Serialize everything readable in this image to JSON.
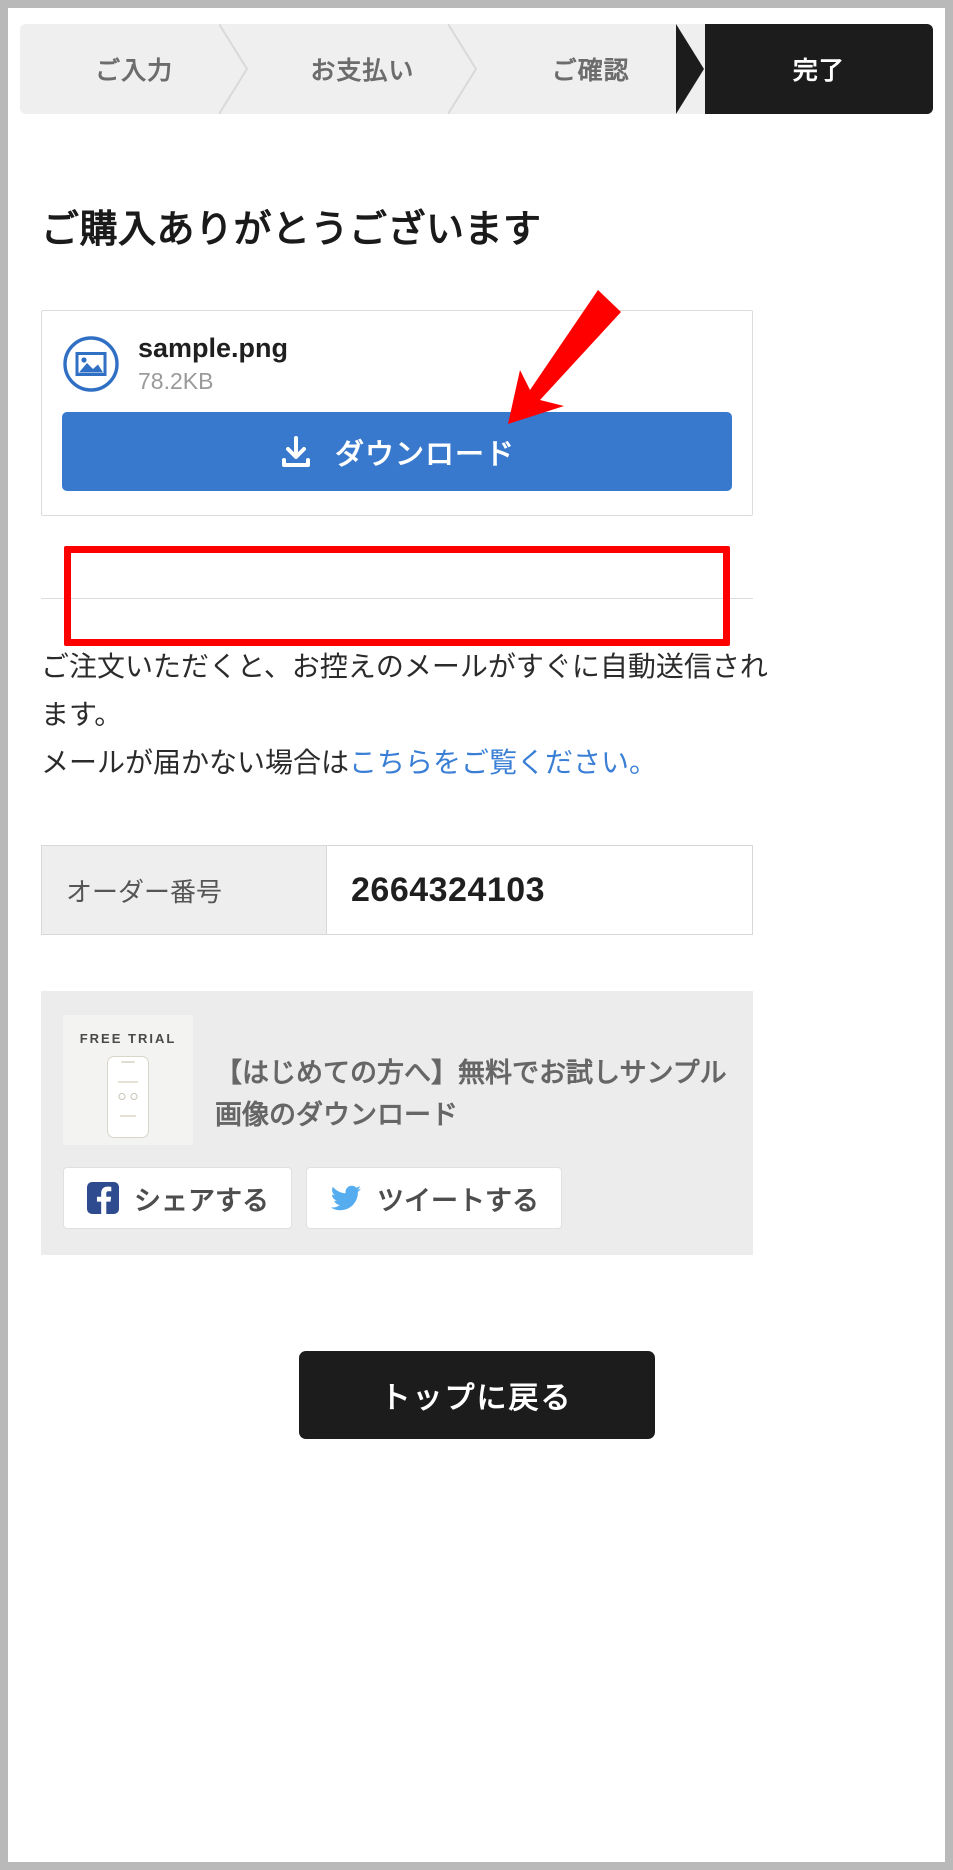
{
  "steps": [
    {
      "label": "ご入力",
      "active": false
    },
    {
      "label": "お支払い",
      "active": false
    },
    {
      "label": "ご確認",
      "active": false
    },
    {
      "label": "完了",
      "active": true
    }
  ],
  "page": {
    "title": "ご購入ありがとうございます"
  },
  "download_card": {
    "file_icon": "image-file-icon",
    "file_name": "sample.png",
    "file_size": "78.2KB",
    "button_label": "ダウンロード",
    "button_icon": "download-icon",
    "button_color": "#3878cd"
  },
  "annotation": {
    "highlight_color": "#ff0000",
    "arrow_color": "#ff0000"
  },
  "notice": {
    "line1": "ご注文いただくと、お控えのメールがすぐに自動送信され",
    "line2": "ます。",
    "line3_prefix": "メールが届かない場合は",
    "link_text": "こちらをご覧ください。",
    "link_color": "#3a7fd5"
  },
  "order": {
    "label": "オーダー番号",
    "value": "2664324103"
  },
  "promo": {
    "thumb_label": "FREE TRIAL",
    "text": "【はじめての方へ】無料でお試しサンプル画像のダウンロード",
    "share": [
      {
        "label": "シェアする",
        "icon": "facebook-icon",
        "color": "#2d4b8e"
      },
      {
        "label": "ツイートする",
        "icon": "twitter-icon",
        "color": "#55acee"
      }
    ]
  },
  "footer": {
    "top_button_label": "トップに戻る"
  }
}
